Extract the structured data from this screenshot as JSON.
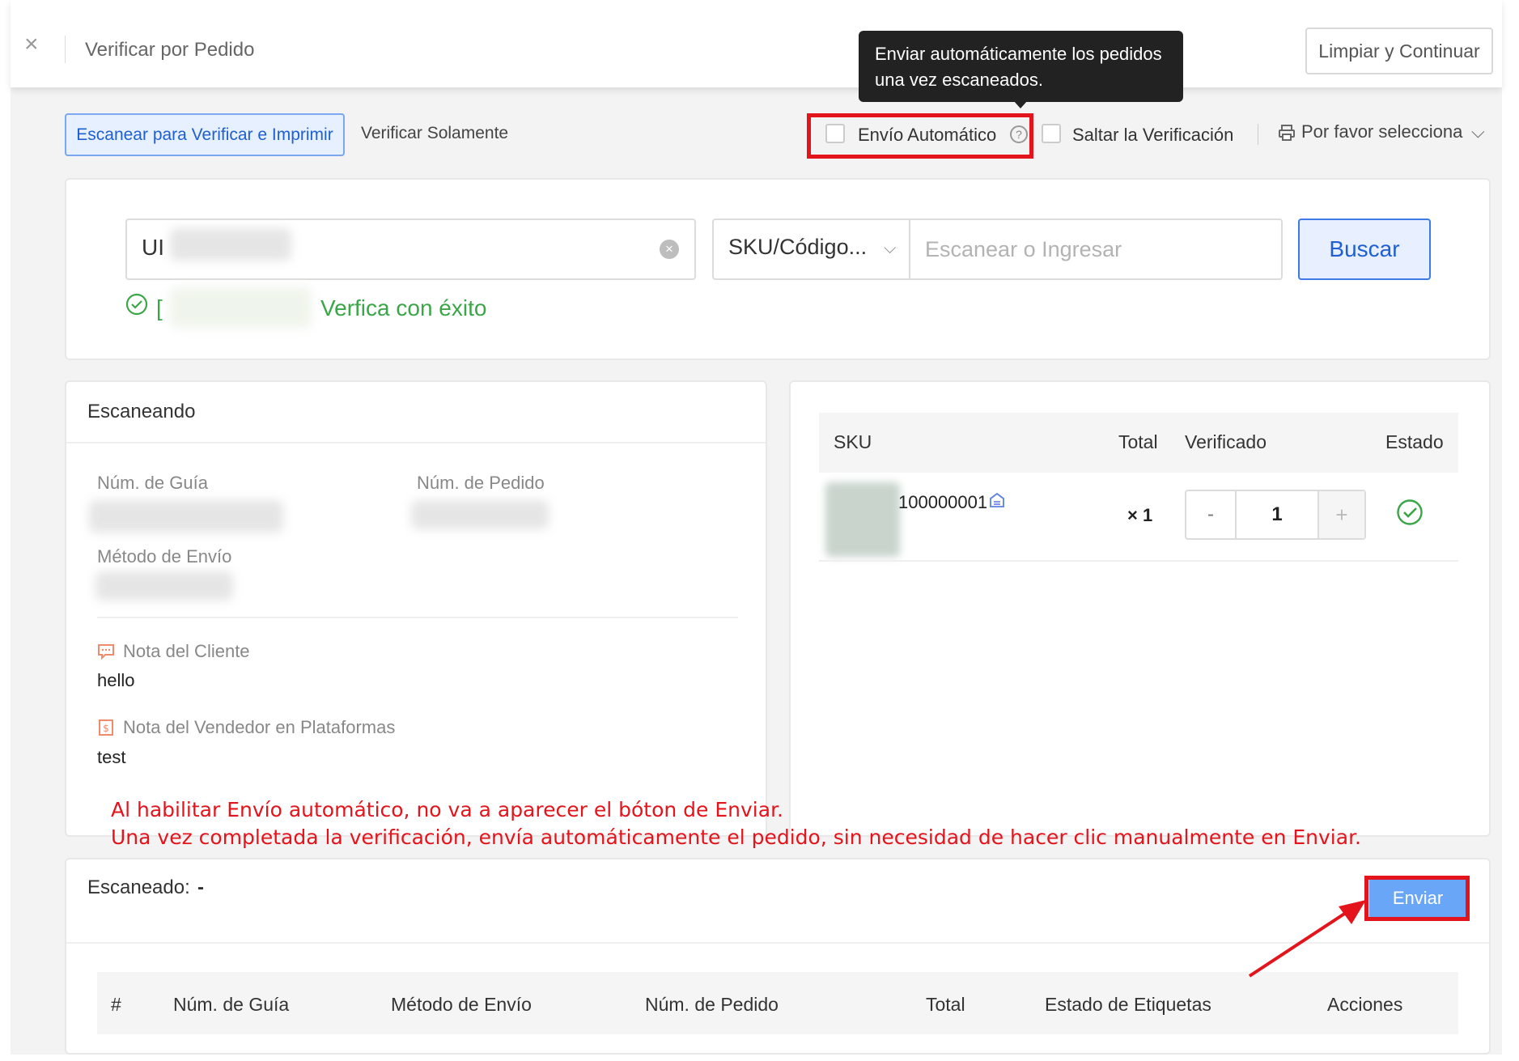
{
  "header": {
    "close_symbol": "×",
    "title": "Verificar por Pedido",
    "clear_button": "Limpiar y Continuar"
  },
  "tooltip": {
    "line1": "Enviar automáticamente los pedidos",
    "line2": "una vez escaneados."
  },
  "tabs": {
    "scan_print": "Escanear para Verificar e Imprimir",
    "verify_only": "Verificar Solamente"
  },
  "options": {
    "auto_ship_label": "Envío Automático",
    "auto_ship_checked": false,
    "help_symbol": "?",
    "skip_label": "Saltar la Verificación",
    "skip_checked": false,
    "printer_label": "Por favor selecciona"
  },
  "search": {
    "order_value_prefix": "UI",
    "sku_type": "SKU/Código...",
    "sku_placeholder": "Escanear o Ingresar",
    "button": "Buscar",
    "result_bracket": "[",
    "result_text": "Verfica con éxito"
  },
  "scanning": {
    "title": "Escaneando",
    "label_guia": "Núm. de Guía",
    "label_pedido": "Núm. de Pedido",
    "label_metodo": "Método de Envío",
    "label_note_client": "Nota del Cliente",
    "note_client": "hello",
    "label_note_seller": "Nota del Vendedor en Plataformas",
    "note_seller": "test"
  },
  "items": {
    "columns": {
      "sku": "SKU",
      "total": "Total",
      "verified": "Verificado",
      "status": "Estado"
    },
    "rows": [
      {
        "sku": "100000001",
        "qty": "× 1",
        "verified": "1",
        "minus": "-",
        "plus": "+"
      }
    ]
  },
  "annotation": {
    "line1": "Al habilitar Envío automático, no va a aparecer el bóton de Enviar.",
    "line2": "Una vez completada la verificación,  envía automáticamente el pedido, sin necesidad de hacer clic manualmente en Enviar."
  },
  "bottom": {
    "scanned_label": "Escaneado:",
    "scanned_value": "-",
    "send_button": "Enviar",
    "columns": {
      "num": "#",
      "guia": "Núm. de Guía",
      "metodo": "Método de Envío",
      "pedido": "Núm. de Pedido",
      "total": "Total",
      "etiquetas": "Estado de Etiquetas",
      "acciones": "Acciones"
    }
  },
  "colors": {
    "accent_blue": "#1f5fd1",
    "highlight_red": "#e3141b",
    "success_green": "#3aa648"
  }
}
